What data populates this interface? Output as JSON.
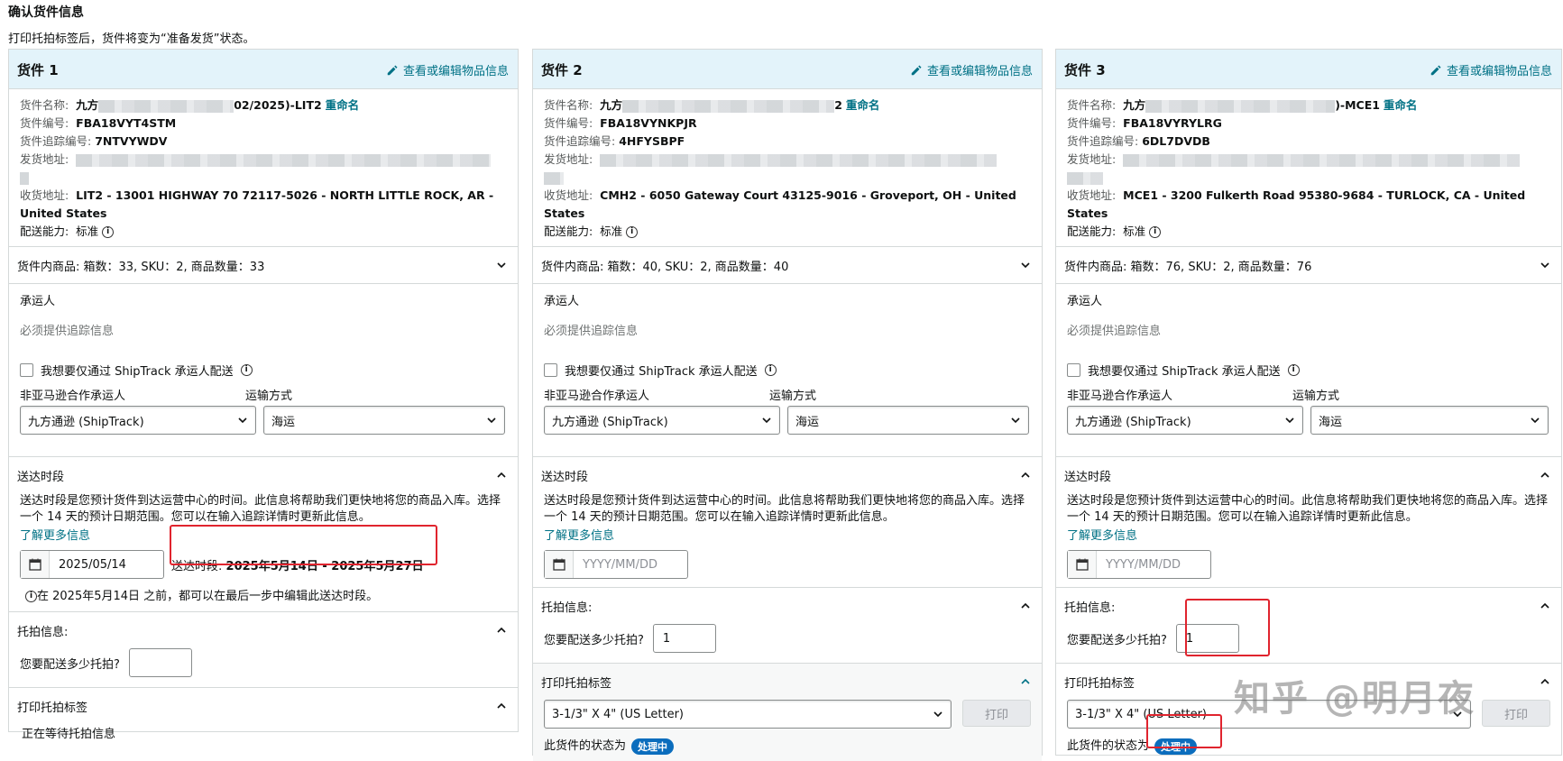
{
  "page": {
    "title": "确认货件信息",
    "subtitle": "打印托拍标签后，货件将变为“准备发货”状态。"
  },
  "common": {
    "edit_link": "查看或编辑物品信息",
    "rename": "重命名",
    "name_label": "货件名称:",
    "id_label": "货件编号:",
    "tracking_label": "货件追踪编号:",
    "ship_from_label": "发货地址:",
    "ship_to_label": "收货地址:",
    "capability_label": "配送能力:",
    "capability_value": "标准",
    "carrier_title": "承运人",
    "tracking_required": "必须提供追踪信息",
    "shiptrack_checkbox": "我想要仅通过 ShipTrack 承运人配送",
    "partner_label": "非亚马逊合作承运人",
    "mode_label": "运输方式",
    "delivery_title": "送达时段",
    "delivery_desc": "送达时段是您预计货件到达运营中心的时间。此信息将帮助我们更快地将您的商品入库。选择一个 14 天的预计日期范围。您可以在输入追踪详情时更新此信息。",
    "learn_more": "了解更多信息",
    "date_placeholder": "YYYY/MM/DD",
    "pallet_title": "托拍信息:",
    "pallet_question": "您要配送多少托拍?",
    "print_title": "打印托拍标签",
    "print_button": "打印",
    "status_label": "此货件的状态为",
    "status_badge": "处理中",
    "label_size": "3-1/3\" X 4\" (US Letter)"
  },
  "shipments": [
    {
      "title": "货件 1",
      "name_prefix": "九方",
      "name_suffix": "02/2025)-LIT2",
      "id": "FBA18VYT4STM",
      "tracking": "7NTVYWDV",
      "ship_to": "LIT2 - 13001 HIGHWAY 70 72117-5026 - NORTH LITTLE ROCK, AR - United States",
      "summary": "货件内商品: 箱数：33, SKU：2, 商品数量：33",
      "carrier": "九方通逊 (ShipTrack)",
      "mode": "海运",
      "date": "2025/05/14",
      "window_label": "送达时段:",
      "window_value": "2025年5月14日 - 2025年5月27日",
      "edit_note": "在 2025年5月14日 之前，都可以在最后一步中编辑此送达时段。",
      "pallets": "",
      "print_status": "正在等待托拍信息"
    },
    {
      "title": "货件 2",
      "name_prefix": "九方",
      "name_suffix": "2",
      "id": "FBA18VYNKPJR",
      "tracking": "4HFYSBPF",
      "ship_to": "CMH2 - 6050 Gateway Court 43125-9016 - Groveport, OH - United States",
      "summary": "货件内商品: 箱数：40, SKU：2, 商品数量：40",
      "carrier": "九方通逊 (ShipTrack)",
      "mode": "海运",
      "pallets": "1"
    },
    {
      "title": "货件 3",
      "name_prefix": "九方",
      "name_suffix": ")-MCE1",
      "id": "FBA18VYRYLRG",
      "tracking": "6DL7DVDB",
      "ship_to": "MCE1 - 3200 Fulkerth Road 95380-9684 - TURLOCK, CA - United States",
      "summary": "货件内商品: 箱数：76, SKU：2, 商品数量：76",
      "carrier": "九方通逊 (ShipTrack)",
      "mode": "海运",
      "pallets": "1"
    }
  ],
  "watermark": "知乎 @明月夜"
}
